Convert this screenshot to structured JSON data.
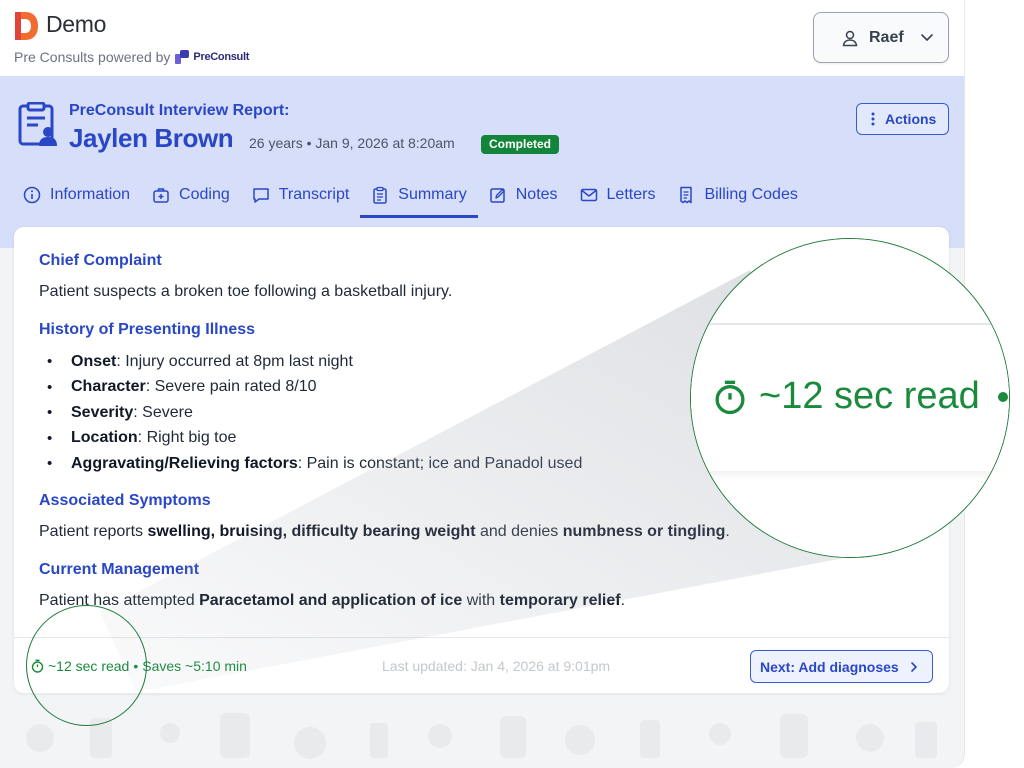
{
  "header": {
    "brand_name": "Demo",
    "powered_by": "Pre Consults powered by",
    "powered_brand": "PreConsult",
    "user_name": "Raef"
  },
  "report": {
    "label": "PreConsult Interview Report:",
    "patient_name": "Jaylen Brown",
    "patient_meta": "26 years • Jan 9, 2026 at 8:20am",
    "status": "Completed",
    "actions_label": "Actions"
  },
  "tabs": [
    {
      "label": "Information",
      "icon": "info-icon"
    },
    {
      "label": "Coding",
      "icon": "medical-bag-icon"
    },
    {
      "label": "Transcript",
      "icon": "chat-icon"
    },
    {
      "label": "Summary",
      "icon": "clipboard-icon",
      "active": true
    },
    {
      "label": "Notes",
      "icon": "edit-icon"
    },
    {
      "label": "Letters",
      "icon": "mail-icon"
    },
    {
      "label": "Billing Codes",
      "icon": "receipt-icon"
    }
  ],
  "summary": {
    "chief_complaint": {
      "title": "Chief Complaint",
      "text": "Patient suspects a broken toe following a basketball injury."
    },
    "hpi": {
      "title": "History of Presenting Illness",
      "items": [
        {
          "label": "Onset",
          "value": ": Injury occurred at 8pm last night"
        },
        {
          "label": "Character",
          "value": ": Severe pain rated 8/10"
        },
        {
          "label": "Severity",
          "value": ": Severe"
        },
        {
          "label": "Location",
          "value": ": Right big toe"
        },
        {
          "label": "Aggravating/Relieving factors",
          "value": ": Pain is constant; ice and Panadol used"
        }
      ]
    },
    "associated": {
      "title": "Associated Symptoms",
      "p1": "Patient reports ",
      "b1": "swelling",
      "p2": ", ",
      "b2": "bruising",
      "p3": ", ",
      "b3": "difficulty bearing weight",
      "p4": " and denies ",
      "b4": "numbness or tingling",
      "p5": "."
    },
    "management": {
      "title": "Current Management",
      "p1": "Patient has attempted ",
      "b1": "Paracetamol and application of ice",
      "p2": " with ",
      "b2": "temporary relief",
      "p3": "."
    }
  },
  "footer": {
    "read_time": "~12 sec read",
    "separator": "•",
    "saves": "Saves ~5:10 min",
    "last_updated": "Last updated: Jan 4, 2026 at 9:01pm",
    "next_label": "Next: Add diagnoses"
  },
  "zoom": {
    "text": "~12 sec read"
  },
  "colors": {
    "accent": "#2a47c5",
    "band": "#d6defa",
    "success": "#1a8a3c",
    "badge": "#12853b"
  }
}
